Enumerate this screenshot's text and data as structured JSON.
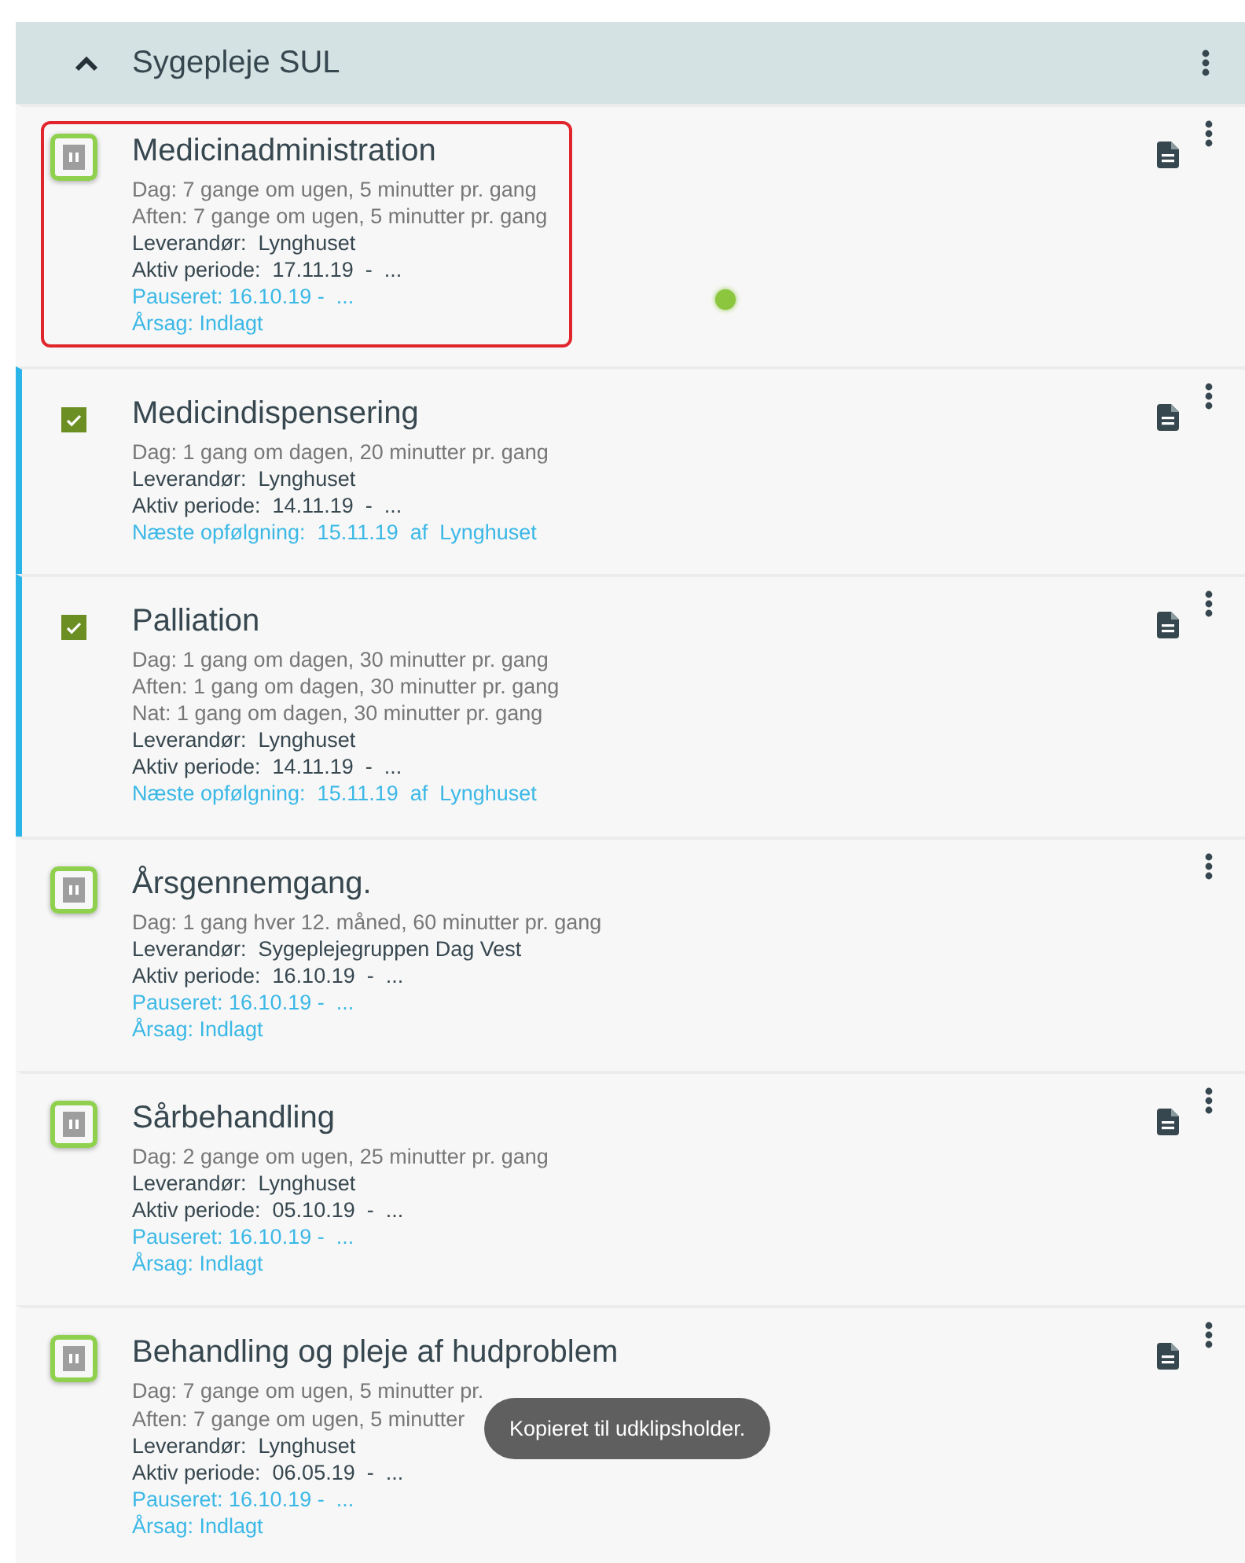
{
  "header": {
    "title": "Sygepleje SUL",
    "expanded": true
  },
  "items": [
    {
      "title": "Medicinadministration",
      "kind": "paused",
      "highlighted": true,
      "outlined": true,
      "has_document": true,
      "lines": [
        {
          "kind": "schedule",
          "text": "Dag: 7 gange om ugen, 5 minutter pr. gang"
        },
        {
          "kind": "schedule",
          "text": "Aften: 7 gange om ugen, 5 minutter pr. gang"
        },
        {
          "kind": "info",
          "text": "Leverandør:  Lynghuset"
        },
        {
          "kind": "info",
          "text": "Aktiv periode:  17.11.19  -  ..."
        },
        {
          "kind": "note",
          "text": "Pauseret: 16.10.19 -  ..."
        },
        {
          "kind": "note",
          "text": "Årsag: Indlagt"
        }
      ]
    },
    {
      "title": "Medicindispensering",
      "kind": "active",
      "highlighted": false,
      "outlined": false,
      "has_document": true,
      "lines": [
        {
          "kind": "schedule",
          "text": "Dag: 1 gang om dagen, 20 minutter pr. gang"
        },
        {
          "kind": "info",
          "text": "Leverandør:  Lynghuset"
        },
        {
          "kind": "info",
          "text": "Aktiv periode:  14.11.19  -  ..."
        },
        {
          "kind": "note",
          "text": "Næste opfølgning:  15.11.19  af  Lynghuset"
        }
      ]
    },
    {
      "title": "Palliation",
      "kind": "active",
      "highlighted": false,
      "outlined": false,
      "has_document": true,
      "lines": [
        {
          "kind": "schedule",
          "text": "Dag: 1 gang om dagen, 30 minutter pr. gang"
        },
        {
          "kind": "schedule",
          "text": "Aften: 1 gang om dagen, 30 minutter pr. gang"
        },
        {
          "kind": "schedule",
          "text": "Nat: 1 gang om dagen, 30 minutter pr. gang"
        },
        {
          "kind": "info",
          "text": "Leverandør:  Lynghuset"
        },
        {
          "kind": "info",
          "text": "Aktiv periode:  14.11.19  -  ..."
        },
        {
          "kind": "note",
          "text": "Næste opfølgning:  15.11.19  af  Lynghuset"
        }
      ]
    },
    {
      "title": "Årsgennemgang.",
      "kind": "paused",
      "highlighted": false,
      "outlined": true,
      "has_document": false,
      "lines": [
        {
          "kind": "schedule",
          "text": "Dag: 1 gang hver 12. måned, 60 minutter pr. gang"
        },
        {
          "kind": "info",
          "text": "Leverandør:  Sygeplejegruppen Dag Vest"
        },
        {
          "kind": "info",
          "text": "Aktiv periode:  16.10.19  -  ..."
        },
        {
          "kind": "note",
          "text": "Pauseret: 16.10.19 -  ..."
        },
        {
          "kind": "note",
          "text": "Årsag: Indlagt"
        }
      ]
    },
    {
      "title": "Sårbehandling",
      "kind": "paused",
      "highlighted": false,
      "outlined": true,
      "has_document": true,
      "lines": [
        {
          "kind": "schedule",
          "text": "Dag: 2 gange om ugen, 25 minutter pr. gang"
        },
        {
          "kind": "info",
          "text": "Leverandør:  Lynghuset"
        },
        {
          "kind": "info",
          "text": "Aktiv periode:  05.10.19  -  ..."
        },
        {
          "kind": "note",
          "text": "Pauseret: 16.10.19 -  ..."
        },
        {
          "kind": "note",
          "text": "Årsag: Indlagt"
        }
      ]
    },
    {
      "title": "Behandling og pleje af hudproblem",
      "kind": "paused",
      "highlighted": false,
      "outlined": true,
      "has_document": true,
      "lines": [
        {
          "kind": "schedule",
          "text": "Dag: 7 gange om ugen, 5 minutter pr."
        },
        {
          "kind": "schedule",
          "text": "Aften: 7 gange om ugen, 5 minutter"
        },
        {
          "kind": "info",
          "text": "Leverandør:  Lynghuset"
        },
        {
          "kind": "info",
          "text": "Aktiv periode:  06.05.19  -  ..."
        },
        {
          "kind": "note",
          "text": "Pauseret: 16.10.19 -  ..."
        },
        {
          "kind": "note",
          "text": "Årsag: Indlagt"
        }
      ]
    }
  ],
  "toast": {
    "text": "Kopieret til udklipsholder."
  }
}
